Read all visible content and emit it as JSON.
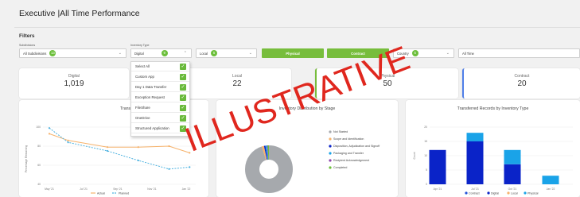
{
  "header": {
    "title": "Executive |All Time Performance"
  },
  "filters": {
    "section_label": "Filters",
    "subdivisions": {
      "label": "Subdivisions",
      "value": "All Subdivisions",
      "count": "13"
    },
    "inventory_type": {
      "label": "Inventory Type",
      "value": "Digital",
      "count": "9"
    },
    "local": {
      "value": "Local",
      "count": "5"
    },
    "physical_button": "Physical",
    "contract_button": "Contract",
    "country": {
      "value": "Country",
      "count": "5"
    },
    "time": {
      "value": "All Time"
    }
  },
  "kpis": [
    {
      "label": "Digital",
      "value": "1,019"
    },
    {
      "label": "Local",
      "value": "22"
    },
    {
      "label": "Physical",
      "value": "50"
    },
    {
      "label": "Contract",
      "value": "20"
    }
  ],
  "dropdown": {
    "items": [
      "Select All",
      "Custom App",
      "Day 1 Data Transfer",
      "Exception Request",
      "FileShare",
      "OneDrive",
      "Structured Application"
    ]
  },
  "panels": {
    "burndown": {
      "title": "Transfer Burndown",
      "ylabel": "Percentage Remaining",
      "legend": [
        "Actual",
        "Planned"
      ]
    },
    "donut": {
      "title": "Inventory Distribution by Stage",
      "legend": [
        "Not Started",
        "Scope and Identification",
        "Disposition, Adjudication and Signoff",
        "Packaging and Transfer",
        "Recipient Acknowledgement",
        "Completed"
      ]
    },
    "transferred": {
      "title": "Transferred Records by Inventory Type",
      "ylabel": "Count",
      "legend": [
        "Contract",
        "Digital",
        "Local",
        "Physical"
      ]
    }
  },
  "colors": {
    "accent_green": "#77bd3c",
    "actual_line": "#f6b26b",
    "planned_line": "#4fb3e0",
    "digital_bar": "#0a23c8",
    "physical_bar": "#1aa3e8",
    "donut_main": "#a6a9ad",
    "watermark": "#e0271e"
  },
  "watermark": "ILLUSTRATIVE",
  "chart_data": [
    {
      "type": "line",
      "title": "Transfer Burndown",
      "ylabel": "Percentage Remaining",
      "x": [
        "May '21",
        "Jul '21",
        "Sep '21",
        "Nov '21",
        "Jan '22"
      ],
      "ylim": [
        40,
        100
      ],
      "yticks": [
        40,
        60,
        80,
        100
      ],
      "series": [
        {
          "name": "Actual",
          "x_index": [
            0,
            0.55,
            1.7,
            2.6,
            3.5,
            4.1
          ],
          "values": [
            93,
            86,
            79,
            79,
            80,
            73
          ]
        },
        {
          "name": "Planned",
          "x_index": [
            0,
            0.55,
            1.7,
            2.6,
            3.5,
            4.1
          ],
          "values": [
            99,
            84,
            75,
            65,
            56,
            58
          ]
        }
      ]
    },
    {
      "type": "pie",
      "title": "Inventory Distribution by Stage",
      "categories": [
        "Not Started",
        "Scope and Identification",
        "Disposition, Adjudication and Signoff",
        "Packaging and Transfer",
        "Recipient Acknowledgement",
        "Completed"
      ],
      "values": [
        95,
        1.5,
        1,
        1,
        0.5,
        1
      ],
      "colors": [
        "#a6a9ad",
        "#f6b26b",
        "#0a23c8",
        "#1aa3e8",
        "#8e44ad",
        "#6cbf3b"
      ]
    },
    {
      "type": "bar",
      "title": "Transferred Records by Inventory Type",
      "ylabel": "Count",
      "categories": [
        "Apr '21",
        "Jul '21",
        "Oct '21",
        "Jan '22"
      ],
      "ylim": [
        0,
        20
      ],
      "yticks": [
        0,
        5,
        10,
        15,
        20
      ],
      "series": [
        {
          "name": "Contract",
          "values": [
            0,
            0,
            0,
            0
          ]
        },
        {
          "name": "Digital",
          "values": [
            12,
            15,
            7,
            0
          ]
        },
        {
          "name": "Local",
          "values": [
            0,
            0,
            0,
            0
          ]
        },
        {
          "name": "Physical",
          "values": [
            0,
            3,
            5,
            3
          ]
        }
      ]
    }
  ]
}
